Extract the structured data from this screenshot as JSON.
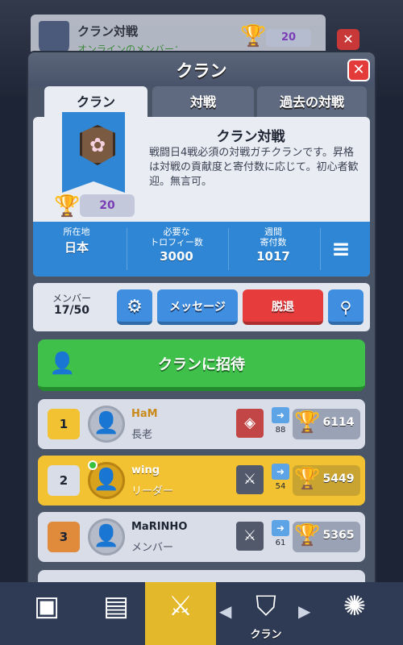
{
  "background": {
    "card_title": "クラン対戦",
    "card_sub": "オンラインのメンバー：",
    "card_trophies": "20"
  },
  "modal": {
    "title": "クラン",
    "close_label": "✕"
  },
  "tabs": [
    {
      "label": "クラン"
    },
    {
      "label": "対戦"
    },
    {
      "label": "過去の対戦"
    }
  ],
  "clan": {
    "name": "クラン対戦",
    "description": "戦闘日4戦必須の対戦ガチクランです。昇格は対戦の貢献度と寄付数に応じて。初心者歓迎。無言可。",
    "trophies": "20"
  },
  "stats": [
    {
      "label": "所在地",
      "value": "日本"
    },
    {
      "label": "必要な\nトロフィー数",
      "value": "3000"
    },
    {
      "label": "週間\n寄付数",
      "value": "1017"
    }
  ],
  "members_bar": {
    "label": "メンバー",
    "count": "17/50",
    "message_label": "メッセージ",
    "leave_label": "脱退"
  },
  "invite": {
    "label": "クランに招待"
  },
  "members": [
    {
      "rank": "1",
      "name": "HaM",
      "role": "長老",
      "donations": "88",
      "trophies": "6114",
      "online": false
    },
    {
      "rank": "2",
      "name": "wing",
      "role": "リーダー",
      "donations": "54",
      "trophies": "5449",
      "online": true
    },
    {
      "rank": "3",
      "name": "MaRINHO",
      "role": "メンバー",
      "donations": "61",
      "trophies": "5365",
      "online": false
    }
  ],
  "bottom_nav": {
    "active_label": "クラン"
  },
  "colors": {
    "accent_blue": "#2e86d4",
    "invite_green": "#3fc04a",
    "leave_red": "#e63c3c",
    "leader_gold": "#f2c232"
  }
}
